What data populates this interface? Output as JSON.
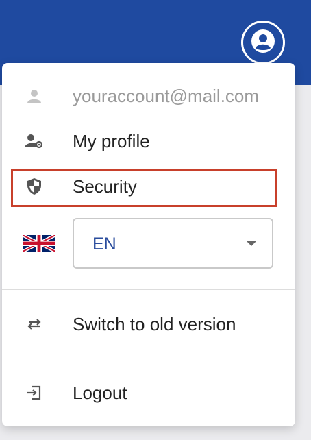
{
  "account": {
    "avatar_icon": "account-circle-icon",
    "email": "youraccount@mail.com"
  },
  "menu": {
    "profile_label": "My profile",
    "security_label": "Security",
    "language": {
      "flag_icon": "uk-flag-icon",
      "selected": "EN"
    },
    "switch_label": "Switch to old version",
    "logout_label": "Logout"
  },
  "colors": {
    "header": "#1f4aa0",
    "highlight": "#c8402b",
    "language_text": "#2a4c9d"
  }
}
